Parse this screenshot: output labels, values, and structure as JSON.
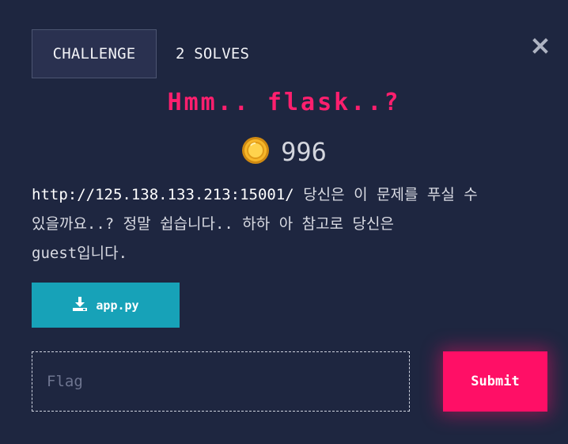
{
  "tabs": [
    {
      "label": "CHALLENGE"
    },
    {
      "label": "2 SOLVES"
    }
  ],
  "challenge": {
    "title": "Hmm..  flask..?",
    "points": "996",
    "description_url": "http://125.138.133.213:15001/",
    "description_line1": "당신은 이 문제를 푸실 수",
    "description_line2": "있을까요..? 정말 쉽습니다.. 하하 아 참고로 당신은",
    "description_line3": "guest입니다."
  },
  "file": {
    "name": "app.py",
    "icon": "download-icon"
  },
  "form": {
    "flag_placeholder": "Flag",
    "flag_value": "",
    "submit_label": "Submit"
  },
  "colors": {
    "background": "#1e2640",
    "title": "#ff1f6e",
    "download_button": "#17a2b8",
    "submit_button": "#ff0f66"
  }
}
